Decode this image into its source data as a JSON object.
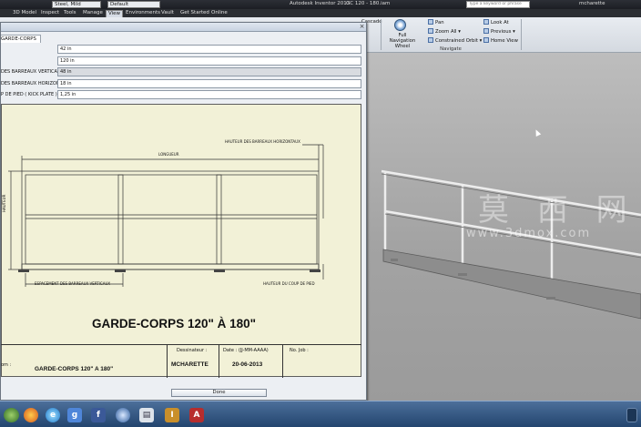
{
  "titlebar": {
    "material": "Steel, Mild",
    "appearance": "Default",
    "app_title": "Autodesk Inventor 2013",
    "file_title": "GC 120 - 180.iam",
    "search_placeholder": "Type a keyword or phrase",
    "user": "mcharette"
  },
  "ribbon_tabs": [
    {
      "label": "3D Model"
    },
    {
      "label": "Inspect"
    },
    {
      "label": "Tools"
    },
    {
      "label": "Manage"
    },
    {
      "label": "View"
    },
    {
      "label": "Environments"
    },
    {
      "label": "Vault"
    },
    {
      "label": "Get Started"
    },
    {
      "label": "Online"
    }
  ],
  "ribbon": {
    "cascade": "Cascade",
    "full_nav_wheel": "Full Navigation Wheel",
    "pan": "Pan",
    "zoom_all": "Zoom All",
    "constrained_orbit": "Constrained Orbit",
    "look_at": "Look At",
    "previous": "Previous",
    "home_view": "Home View",
    "group_label": "Navigate"
  },
  "dialog": {
    "tab_label": "GARDE-CORPS",
    "params": [
      {
        "label": "",
        "value": "42 in"
      },
      {
        "label": "",
        "value": "120 in"
      },
      {
        "label": "DES BARREAUX VERTICAUX",
        "value": "48 in"
      },
      {
        "label": "DES BARREAUX HORIZONTAL",
        "value": "18 in"
      },
      {
        "label": "P DE PIED ( KICK PLATE )",
        "value": "1,25 in"
      }
    ],
    "drawing": {
      "longueur": "LONGUEUR",
      "hauteur": "HAUTEUR",
      "hauteur_barreaux": "HAUTEUR DES BARREAUX HORIZONTAUX",
      "espacement": "ESPACEMENT DES BARREAUX VERTICAUX",
      "hauteur_coup": "HAUTEUR DU COUP DE PIED"
    },
    "main_title": "GARDE-CORPS 120\" À 180\"",
    "titleblock": {
      "nom_cap": "om :",
      "nom_val": "GARDE-CORPS 120\" A 180\"",
      "dessinateur_cap": "Dessinateur :",
      "dessinateur_val": "MCHARETTE",
      "date_cap": "Date : (JJ-MM-AAAA)",
      "date_val": "20-06-2013",
      "job_cap": "No. Job :"
    },
    "done_label": "Done"
  },
  "watermark": {
    "big": "莫 西 网",
    "url": "www.3dmox.com"
  },
  "taskbar_icons": [
    "firefox-icon",
    "ie-icon",
    "google-icon",
    "facebook-icon",
    "thunderbird-icon",
    "app-icon",
    "inventor-icon",
    "autocad-icon"
  ]
}
